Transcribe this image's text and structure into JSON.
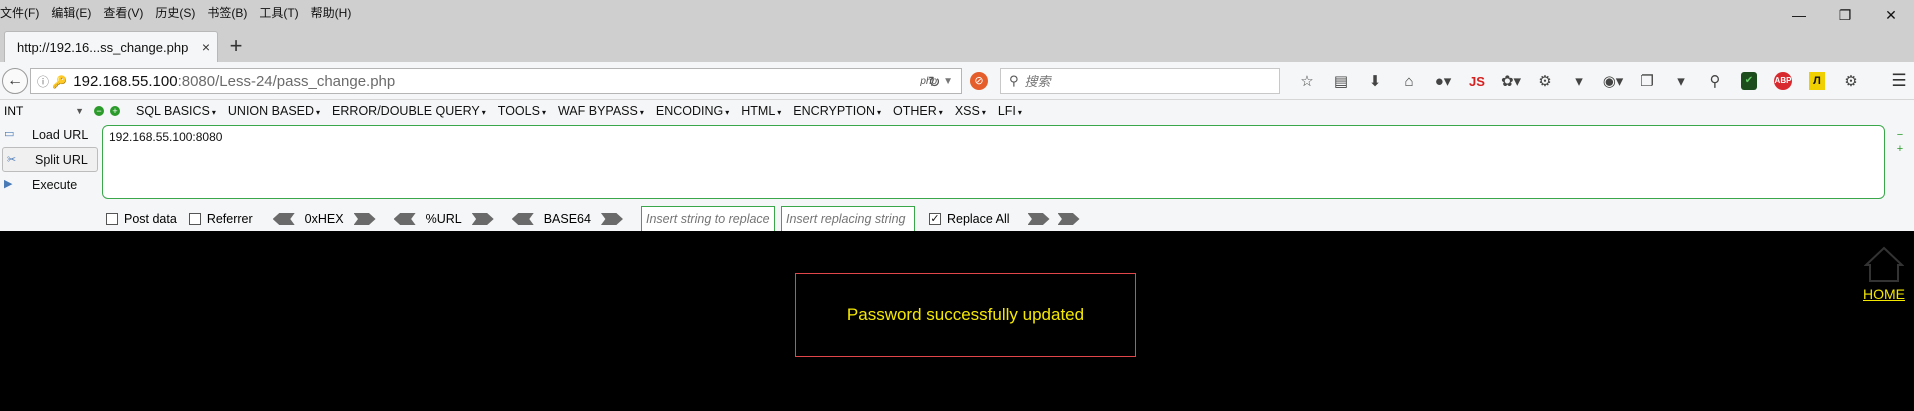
{
  "menubar": {
    "items": [
      "文件(F)",
      "编辑(E)",
      "查看(V)",
      "历史(S)",
      "书签(B)",
      "工具(T)",
      "帮助(H)"
    ],
    "window_controls": [
      "minimize-icon",
      "restore-icon",
      "close-icon"
    ]
  },
  "tab": {
    "title": "http://192.16...ss_change.php",
    "close": "×",
    "new_tab": "+"
  },
  "navbar": {
    "url_host": "192.168.55.100",
    "url_rest": ":8080/Less-24/pass_change.php",
    "php_badge": "php",
    "search_placeholder": "搜索",
    "js_label": "JS",
    "abp_label": "ABP",
    "yellow_label": "Л"
  },
  "hackbar": {
    "select_value": "INT",
    "menus": [
      "SQL BASICS",
      "UNION BASED",
      "ERROR/DOUBLE QUERY",
      "TOOLS",
      "WAF BYPASS",
      "ENCODING",
      "HTML",
      "ENCRYPTION",
      "OTHER",
      "XSS",
      "LFI"
    ],
    "load_url": "Load URL",
    "split_url": "Split URL",
    "execute": "Execute",
    "textarea_value": "192.168.55.100:8080",
    "post_data": "Post data",
    "referrer": "Referrer",
    "hex": "0xHEX",
    "url_enc": "%URL",
    "base64": "BASE64",
    "replace_placeholder": "Insert string to replace",
    "replacing_placeholder": "Insert replacing string",
    "replace_all": "Replace All",
    "replace_all_checked": true
  },
  "page": {
    "message": "Password successfully updated",
    "home_label": "HOME"
  },
  "colors": {
    "message_text": "#f5e800",
    "message_border": "#e0464a",
    "background": "#000000",
    "hackbar_border": "#3aa84a"
  }
}
